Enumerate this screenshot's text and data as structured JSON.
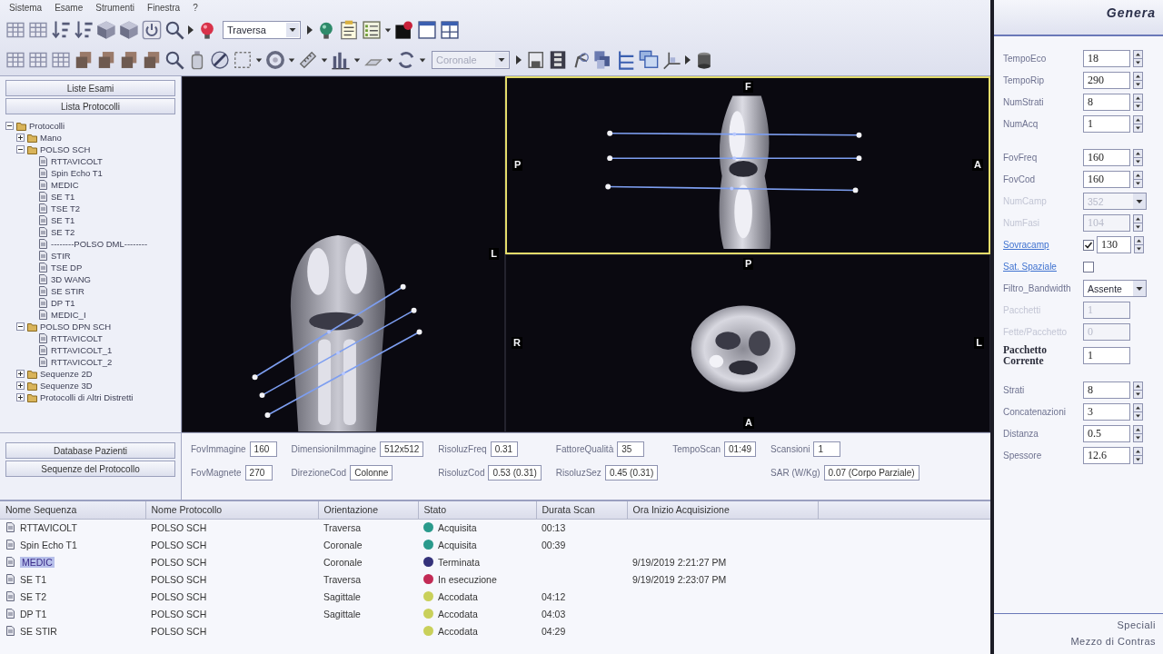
{
  "toolbar": {
    "menu": [
      "Sistema",
      "Esame",
      "Strumenti",
      "Finestra",
      "?"
    ],
    "dropdowns": [
      {
        "value": "Traversa",
        "disabled": false
      },
      {
        "value": "Coronale",
        "disabled": true
      }
    ]
  },
  "left_panel": {
    "buttons": [
      "Liste Esami",
      "Lista Protocolli"
    ],
    "tree": [
      {
        "label": "Protocolli",
        "kind": "folder",
        "expanded": true,
        "children": [
          {
            "label": "Mano",
            "kind": "folder",
            "expanded": false
          },
          {
            "label": "POLSO SCH",
            "kind": "folder",
            "expanded": true,
            "children": [
              {
                "label": "RTTAVICOLT",
                "kind": "sequence"
              },
              {
                "label": "Spin Echo T1",
                "kind": "sequence"
              },
              {
                "label": "MEDIC",
                "kind": "sequence"
              },
              {
                "label": "SE T1",
                "kind": "sequence"
              },
              {
                "label": "TSE T2",
                "kind": "sequence"
              },
              {
                "label": "SE T1",
                "kind": "sequence"
              },
              {
                "label": "SE T2",
                "kind": "sequence"
              },
              {
                "label": "--------POLSO DML--------",
                "kind": "sequence"
              },
              {
                "label": "STIR",
                "kind": "sequence"
              },
              {
                "label": "TSE DP",
                "kind": "sequence"
              },
              {
                "label": "3D WANG",
                "kind": "sequence"
              },
              {
                "label": "SE STIR",
                "kind": "sequence"
              },
              {
                "label": "DP T1",
                "kind": "sequence"
              },
              {
                "label": "MEDIC_I",
                "kind": "sequence"
              }
            ]
          },
          {
            "label": "POLSO DPN SCH",
            "kind": "folder",
            "expanded": true,
            "children": [
              {
                "label": "RTTAVICOLT",
                "kind": "sequence"
              },
              {
                "label": "RTTAVICOLT_1",
                "kind": "sequence"
              },
              {
                "label": "RTTAVICOLT_2",
                "kind": "sequence"
              }
            ]
          },
          {
            "label": "Sequenze 2D",
            "kind": "folder",
            "expanded": false
          },
          {
            "label": "Sequenze 3D",
            "kind": "folder",
            "expanded": false
          },
          {
            "label": "Protocolli di Altri Distretti",
            "kind": "folder",
            "expanded": false
          }
        ]
      }
    ]
  },
  "viewer": {
    "viewports": [
      {
        "kind": "coronal",
        "selected": false,
        "marker_right": "L"
      },
      {
        "kind": "sagittal",
        "selected": true,
        "marker_top": "F",
        "marker_left": "P",
        "marker_right": "A"
      },
      {
        "kind": "axial",
        "selected": false,
        "marker_top": "P",
        "marker_left": "R",
        "marker_right": "L",
        "marker_bottom": "A"
      }
    ]
  },
  "bottom_left": {
    "buttons": [
      "Database Pazienti",
      "Sequenze del Protocollo"
    ]
  },
  "params": {
    "columns": [
      {
        "fields": [
          {
            "label": "FovImmagine",
            "value": "160"
          },
          {
            "label": "FovMagnete",
            "value": "270"
          }
        ]
      },
      {
        "fields": [
          {
            "label": "DimensioniImmagine",
            "value": "512x512"
          },
          {
            "label": "DirezioneCod",
            "value": "Colonne"
          }
        ]
      },
      {
        "fields": [
          {
            "label": "RisoluzFreq",
            "value": "0.31"
          },
          {
            "label": "RisoluzCod",
            "value": "0.53 (0.31)"
          }
        ]
      },
      {
        "fields": [
          {
            "label": "FattoreQualità",
            "value": "35"
          },
          {
            "label": "RisoluzSez",
            "value": "0.45 (0.31)"
          }
        ]
      },
      {
        "fields": [
          {
            "label": "TempoScan",
            "value": "01:49"
          }
        ]
      },
      {
        "fields": [
          {
            "label": "Scansioni",
            "value": "1"
          },
          {
            "label": "SAR (W/Kg)",
            "value": "0.07 (Corpo Parziale)"
          }
        ]
      }
    ]
  },
  "table": {
    "columns": [
      "Nome Sequenza",
      "Nome Protocollo",
      "Orientazione",
      "Stato",
      "Durata Scan",
      "Ora Inizio Acquisizione"
    ],
    "rows": [
      {
        "sequence": "RTTAVICOLT",
        "protocol": "POLSO SCH",
        "orientation": "Traversa",
        "status": "Acquisita",
        "color": "#2a9a8c",
        "duration": "00:13",
        "selected": false
      },
      {
        "sequence": "Spin Echo T1",
        "protocol": "POLSO SCH",
        "orientation": "Coronale",
        "status": "Acquisita",
        "color": "#2a9a8c",
        "duration": "00:39",
        "selected": false
      },
      {
        "sequence": "MEDIC",
        "protocol": "POLSO SCH",
        "orientation": "Coronale",
        "status": "Terminata",
        "color": "#35327a",
        "start": "9/19/2019 2:21:27 PM",
        "selected": true
      },
      {
        "sequence": "SE T1",
        "protocol": "POLSO SCH",
        "orientation": "Traversa",
        "status": "In esecuzione",
        "color": "#c22a55",
        "start": "9/19/2019 2:23:07 PM",
        "selected": false
      },
      {
        "sequence": "SE T2",
        "protocol": "POLSO SCH",
        "orientation": "Sagittale",
        "status": "Accodata",
        "color": "#c9d05a",
        "duration": "04:12",
        "selected": false
      },
      {
        "sequence": "DP T1",
        "protocol": "POLSO SCH",
        "orientation": "Sagittale",
        "status": "Accodata",
        "color": "#c9d05a",
        "duration": "04:03",
        "selected": false
      },
      {
        "sequence": "SE STIR",
        "protocol": "POLSO SCH",
        "status": "Accodata",
        "color": "#c9d05a",
        "duration": "04:29",
        "selected": false
      }
    ]
  },
  "right_panel": {
    "tabs": [
      {
        "label": "Genera",
        "selected": true
      },
      {
        "label": "Speciali",
        "selected": false
      },
      {
        "label": "Mezzo di Contras",
        "selected": false
      }
    ],
    "groups": [
      {
        "fields": [
          {
            "kind": "spin",
            "label": "TempoEco",
            "value": "18",
            "disabled": false,
            "link": false
          },
          {
            "kind": "spin",
            "label": "TempoRip",
            "value": "290",
            "disabled": false,
            "link": false
          },
          {
            "kind": "spin",
            "label": "NumStrati",
            "value": "8",
            "disabled": false,
            "link": false
          },
          {
            "kind": "spin",
            "label": "NumAcq",
            "value": "1",
            "disabled": false,
            "link": false
          }
        ]
      },
      {
        "fields": [
          {
            "kind": "spin",
            "label": "FovFreq",
            "value": "160",
            "disabled": false,
            "link": false
          },
          {
            "kind": "spin",
            "label": "FovCod",
            "value": "160",
            "disabled": false,
            "link": false
          },
          {
            "kind": "dropdown",
            "label": "NumCamp",
            "value": "352",
            "disabled": true,
            "link": false
          },
          {
            "kind": "spin",
            "label": "NumFasi",
            "value": "104",
            "disabled": true,
            "link": false
          },
          {
            "kind": "checkspin",
            "label": "Sovracamp",
            "value": "130",
            "checked": true,
            "disabled": false,
            "link": true
          },
          {
            "kind": "check",
            "label": "Sat. Spaziale",
            "checked": false,
            "disabled": false,
            "link": true
          },
          {
            "kind": "dropdown",
            "label": "Filtro_Bandwidth",
            "value": "Assente",
            "disabled": false,
            "link": false
          },
          {
            "kind": "text",
            "label": "Pacchetti",
            "value": "1",
            "disabled": true,
            "link": false
          },
          {
            "kind": "text",
            "label": "Fette/Pacchetto",
            "value": "0",
            "disabled": true,
            "link": false
          },
          {
            "kind": "text",
            "label": "Pacchetto Corrente",
            "value": "1",
            "disabled": false,
            "link": false,
            "bold": true
          }
        ]
      },
      {
        "fields": [
          {
            "kind": "spin",
            "label": "Strati",
            "value": "8",
            "disabled": false,
            "link": false
          },
          {
            "kind": "spin",
            "label": "Concatenazioni",
            "value": "3",
            "disabled": false,
            "link": false
          },
          {
            "kind": "spin",
            "label": "Distanza",
            "value": "0.5",
            "disabled": false,
            "link": false
          },
          {
            "kind": "spin",
            "label": "Spessore",
            "value": "12.6",
            "disabled": false,
            "link": false
          }
        ]
      }
    ]
  }
}
